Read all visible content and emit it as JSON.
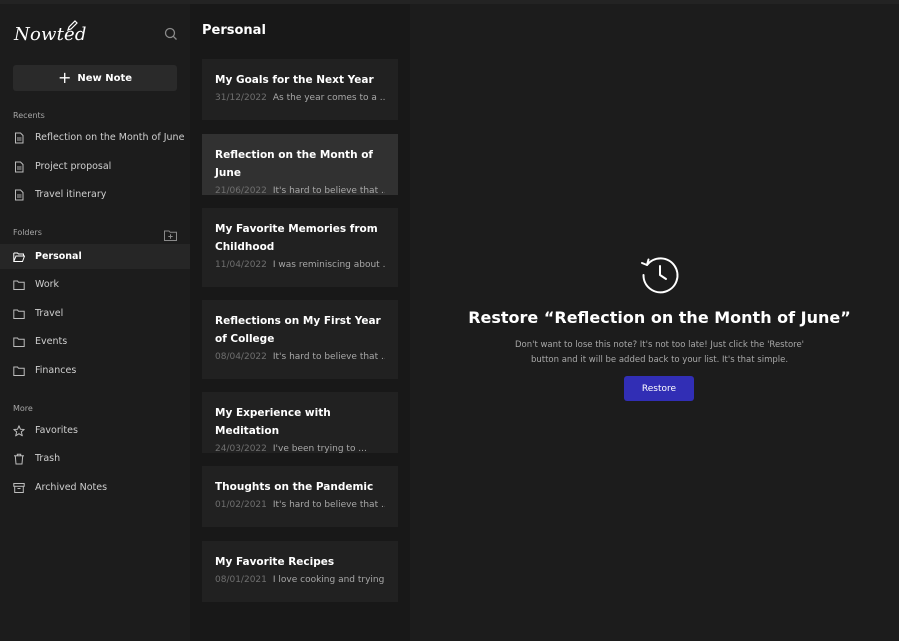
{
  "app": {
    "logo_text": "Nowted"
  },
  "sidebar": {
    "new_note_label": "New Note",
    "recents_title": "Recents",
    "recents": [
      {
        "label": "Reflection on the Month of June"
      },
      {
        "label": "Project proposal"
      },
      {
        "label": "Travel itinerary"
      }
    ],
    "folders_title": "Folders",
    "folders": [
      {
        "label": "Personal",
        "active": true
      },
      {
        "label": "Work"
      },
      {
        "label": "Travel"
      },
      {
        "label": "Events"
      },
      {
        "label": "Finances"
      }
    ],
    "more_title": "More",
    "more": [
      {
        "label": "Favorites",
        "icon": "star-icon"
      },
      {
        "label": "Trash",
        "icon": "trash-icon"
      },
      {
        "label": "Archived Notes",
        "icon": "archive-icon"
      }
    ]
  },
  "notes": {
    "folder_title": "Personal",
    "items": [
      {
        "title": "My Goals for the Next Year",
        "date": "31/12/2022",
        "snippet": "As the year comes to a ..."
      },
      {
        "title": "Reflection on the Month of June",
        "date": "21/06/2022",
        "snippet": "It's hard to believe that ...",
        "active": true
      },
      {
        "title": "My Favorite Memories from Childhood",
        "date": "11/04/2022",
        "snippet": "I was reminiscing about ..."
      },
      {
        "title": "Reflections on My First Year of College",
        "date": "08/04/2022",
        "snippet": "It's hard to believe that ..."
      },
      {
        "title": "My Experience with Meditation",
        "date": "24/03/2022",
        "snippet": "I've been trying to ..."
      },
      {
        "title": "Thoughts on the Pandemic",
        "date": "01/02/2021",
        "snippet": "It's hard to believe that ..."
      },
      {
        "title": "My Favorite Recipes",
        "date": "08/01/2021",
        "snippet": "I love cooking and trying ..."
      }
    ]
  },
  "main": {
    "restore_title": "Restore “Reflection on the Month of June”",
    "restore_desc": "Don't want to lose this note? It's not too late! Just click the 'Restore' button and it will be added back to your list. It's that simple.",
    "restore_button": "Restore"
  },
  "colors": {
    "accent": "#312eb5",
    "bg": "#1c1c1c",
    "card": "#212121",
    "card_active": "#313131"
  }
}
